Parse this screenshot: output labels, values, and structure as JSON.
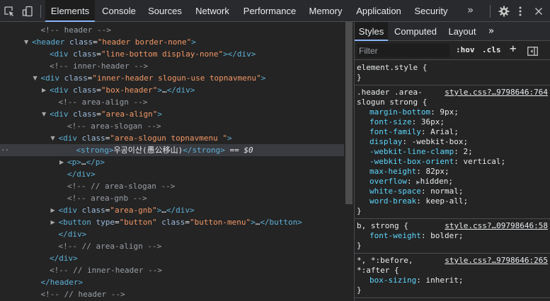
{
  "toolbar": {
    "tabs": [
      "Elements",
      "Console",
      "Sources",
      "Network",
      "Performance",
      "Memory",
      "Application",
      "Security"
    ],
    "more": "»",
    "icons": [
      "inspect-element-icon",
      "device-toggle-icon",
      "settings-gear-icon",
      "more-vert-icon",
      "close-icon"
    ]
  },
  "tree": [
    {
      "indent": 3,
      "arrow": "",
      "parts": [
        [
          "cm",
          "<!-- header -->"
        ]
      ]
    },
    {
      "indent": 2,
      "arrow": "down",
      "parts": [
        [
          "tg",
          "<header "
        ],
        [
          "an",
          "class"
        ],
        [
          "eq",
          "="
        ],
        [
          "av",
          "\"header border-none\""
        ],
        [
          "tg",
          ">"
        ]
      ]
    },
    {
      "indent": 4,
      "arrow": "",
      "parts": [
        [
          "tg",
          "<div "
        ],
        [
          "an",
          "class"
        ],
        [
          "eq",
          "="
        ],
        [
          "av",
          "\"line-bottom display-none\""
        ],
        [
          "tg",
          "></div>"
        ]
      ]
    },
    {
      "indent": 4,
      "arrow": "",
      "parts": [
        [
          "cm",
          "<!-- inner-header -->"
        ]
      ]
    },
    {
      "indent": 3,
      "arrow": "down",
      "parts": [
        [
          "tg",
          "<div "
        ],
        [
          "an",
          "class"
        ],
        [
          "eq",
          "="
        ],
        [
          "av",
          "\"inner-header slogun-use topnavmenu\""
        ],
        [
          "tg",
          ">"
        ]
      ]
    },
    {
      "indent": 4,
      "arrow": "right",
      "parts": [
        [
          "tg",
          "<div "
        ],
        [
          "an",
          "class"
        ],
        [
          "eq",
          "="
        ],
        [
          "av",
          "\"box-header\""
        ],
        [
          "tg",
          ">"
        ],
        [
          "tx",
          "…"
        ],
        [
          "tg",
          "</div>"
        ]
      ]
    },
    {
      "indent": 5,
      "arrow": "",
      "parts": [
        [
          "cm",
          "<!-- area-align -->"
        ]
      ]
    },
    {
      "indent": 4,
      "arrow": "down",
      "parts": [
        [
          "tg",
          "<div "
        ],
        [
          "an",
          "class"
        ],
        [
          "eq",
          "="
        ],
        [
          "av",
          "\"area-align\""
        ],
        [
          "tg",
          ">"
        ]
      ]
    },
    {
      "indent": 6,
      "arrow": "",
      "parts": [
        [
          "cm",
          "<!-- area-slogan -->"
        ]
      ]
    },
    {
      "indent": 5,
      "arrow": "down",
      "parts": [
        [
          "tg",
          "<div "
        ],
        [
          "an",
          "class"
        ],
        [
          "eq",
          "="
        ],
        [
          "av",
          "\"area-slogun topnavmenu \""
        ],
        [
          "tg",
          ">"
        ]
      ]
    },
    {
      "indent": 7,
      "arrow": "",
      "selected": true,
      "parts": [
        [
          "tg",
          "<strong>"
        ],
        [
          "tx",
          "우공이산(愚公移山)"
        ],
        [
          "tg",
          "</strong>"
        ],
        [
          "eq",
          " == "
        ],
        [
          "dollar",
          "$0"
        ]
      ]
    },
    {
      "indent": 6,
      "arrow": "right",
      "parts": [
        [
          "tg",
          "<p>"
        ],
        [
          "tx",
          "…"
        ],
        [
          "tg",
          "</p>"
        ]
      ]
    },
    {
      "indent": 6,
      "arrow": "",
      "parts": [
        [
          "tg",
          "</div>"
        ]
      ]
    },
    {
      "indent": 6,
      "arrow": "",
      "parts": [
        [
          "cm",
          "<!-- // area-slogan -->"
        ]
      ]
    },
    {
      "indent": 6,
      "arrow": "",
      "parts": [
        [
          "cm",
          "<!-- area-gnb -->"
        ]
      ]
    },
    {
      "indent": 5,
      "arrow": "right",
      "parts": [
        [
          "tg",
          "<div "
        ],
        [
          "an",
          "class"
        ],
        [
          "eq",
          "="
        ],
        [
          "av",
          "\"area-gnb\""
        ],
        [
          "tg",
          ">"
        ],
        [
          "tx",
          "…"
        ],
        [
          "tg",
          "</div>"
        ]
      ]
    },
    {
      "indent": 5,
      "arrow": "right",
      "parts": [
        [
          "tg",
          "<button "
        ],
        [
          "an",
          "type"
        ],
        [
          "eq",
          "="
        ],
        [
          "av",
          "\"button\""
        ],
        [
          "tx",
          " "
        ],
        [
          "an",
          "class"
        ],
        [
          "eq",
          "="
        ],
        [
          "av",
          "\"button-menu\""
        ],
        [
          "tg",
          ">"
        ],
        [
          "tx",
          "…"
        ],
        [
          "tg",
          "</button>"
        ]
      ]
    },
    {
      "indent": 5,
      "arrow": "",
      "parts": [
        [
          "tg",
          "</div>"
        ]
      ]
    },
    {
      "indent": 5,
      "arrow": "",
      "parts": [
        [
          "cm",
          "<!-- // area-align -->"
        ]
      ]
    },
    {
      "indent": 4,
      "arrow": "",
      "parts": [
        [
          "tg",
          "</div>"
        ]
      ]
    },
    {
      "indent": 4,
      "arrow": "",
      "parts": [
        [
          "cm",
          "<!-- // inner-header -->"
        ]
      ]
    },
    {
      "indent": 3,
      "arrow": "",
      "parts": [
        [
          "tg",
          "</header>"
        ]
      ]
    },
    {
      "indent": 3,
      "arrow": "",
      "parts": [
        [
          "cm",
          "<!-- // header -->"
        ]
      ]
    }
  ],
  "styles": {
    "subtabs": [
      "Styles",
      "Computed",
      "Layout"
    ],
    "more": "»",
    "filter_placeholder": "Filter",
    "hov": ":hov",
    "cls": ".cls",
    "plus": "+",
    "rules": [
      {
        "selector": [
          "element.style {"
        ],
        "source": "",
        "decls": [],
        "close": "}"
      },
      {
        "selector": [
          ".header .area-",
          "slogun strong {"
        ],
        "source": "style.css?…9798646:764",
        "decls": [
          [
            "margin-bottom",
            "9px"
          ],
          [
            "font-size",
            "36px"
          ],
          [
            "font-family",
            "Arial"
          ],
          [
            "display",
            "-webkit-box"
          ],
          [
            "-webkit-line-clamp",
            "2"
          ],
          [
            "-webkit-box-orient",
            "vertical"
          ],
          [
            "max-height",
            "82px"
          ],
          [
            "overflow",
            "hidden"
          ],
          [
            "white-space",
            "normal"
          ],
          [
            "word-break",
            "keep-all"
          ]
        ],
        "close": "}"
      },
      {
        "selector": [
          "b, strong {"
        ],
        "source": "style.css?…09798646:58",
        "decls": [
          [
            "font-weight",
            "bolder"
          ]
        ],
        "close": "}"
      },
      {
        "selector": [
          "*, *:before,",
          "*:after {"
        ],
        "source": "style.css?…9798646:265",
        "decls": [
          [
            "box-sizing",
            "inherit"
          ]
        ],
        "close": "}"
      }
    ]
  }
}
